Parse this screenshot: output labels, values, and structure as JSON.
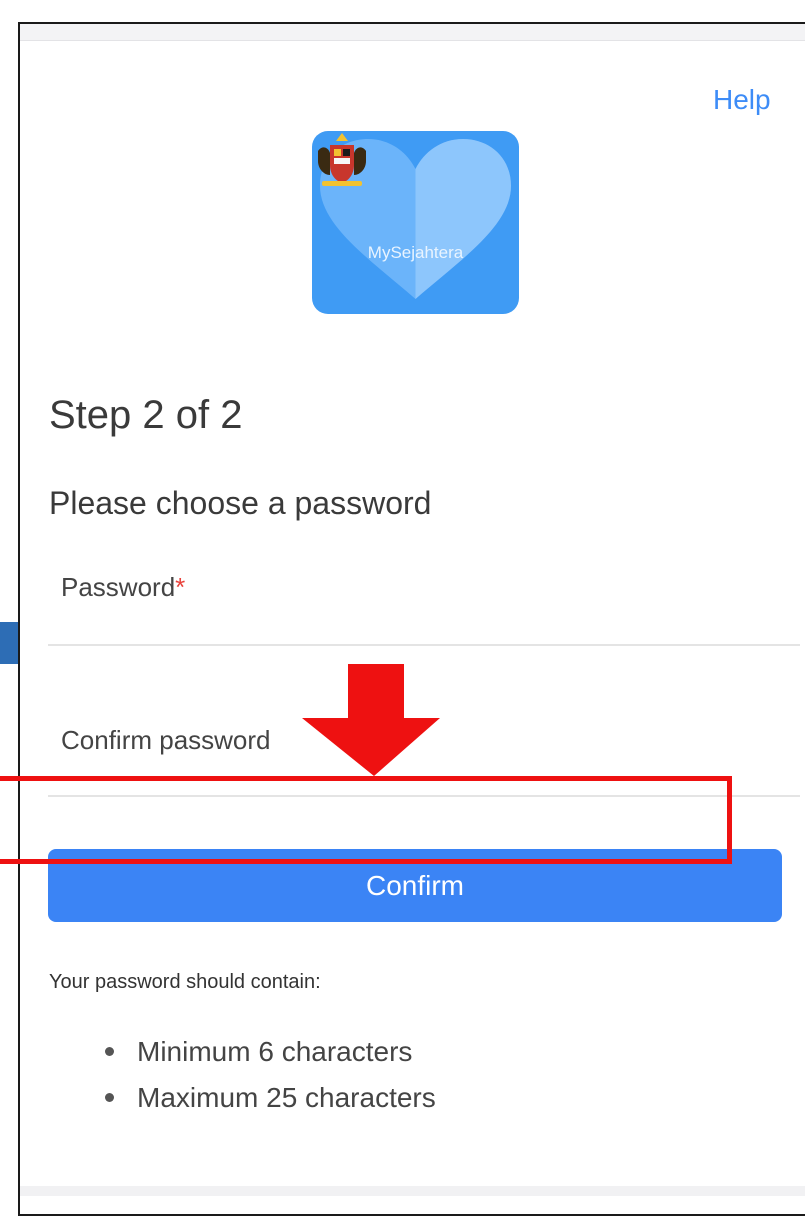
{
  "header": {
    "help_label": "Help"
  },
  "logo": {
    "app_name": "MySejahtera"
  },
  "step": {
    "title": "Step 2 of 2",
    "subtitle": "Please choose a password"
  },
  "form": {
    "password_label": "Password",
    "password_required_mark": "*",
    "confirm_label": "Confirm password",
    "confirm_button": "Confirm"
  },
  "requirements": {
    "heading": "Your password should contain:",
    "items": [
      "Minimum 6 characters",
      "Maximum 25 characters"
    ]
  },
  "colors": {
    "accent": "#3b84f5",
    "link": "#3d8cf7",
    "required": "#e8413b",
    "annotation": "#ee1111"
  }
}
